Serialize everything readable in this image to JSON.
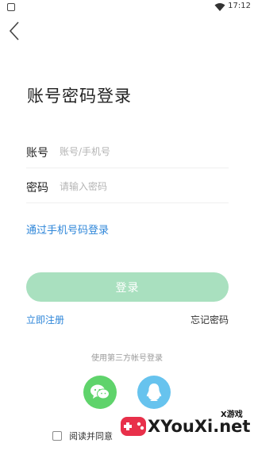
{
  "status_bar": {
    "time": "17:12",
    "icons": [
      "notification-icon",
      "wifi-icon",
      "battery-icon"
    ]
  },
  "header": {
    "back_icon": "chevron-left-icon"
  },
  "page": {
    "title": "账号密码登录"
  },
  "form": {
    "account_label": "账号",
    "account_placeholder": "账号/手机号",
    "account_value": "",
    "password_label": "密码",
    "password_placeholder": "请输入密码",
    "password_value": ""
  },
  "links": {
    "phone_login": "通过手机号码登录",
    "register": "立即注册",
    "forgot_password": "忘记密码"
  },
  "login_button": {
    "label": "登录"
  },
  "third_party": {
    "label": "使用第三方帐号登录",
    "providers": [
      "wechat-icon",
      "qq-icon"
    ]
  },
  "agreement": {
    "text": "阅读并同意",
    "checked": false
  },
  "watermark": {
    "main": "XYouXi.net",
    "sub": "X游戏"
  },
  "colors": {
    "link": "#2e86d9",
    "login_button": "#a9e0bf",
    "wechat": "#5fd36b",
    "qq": "#67c3ee"
  }
}
